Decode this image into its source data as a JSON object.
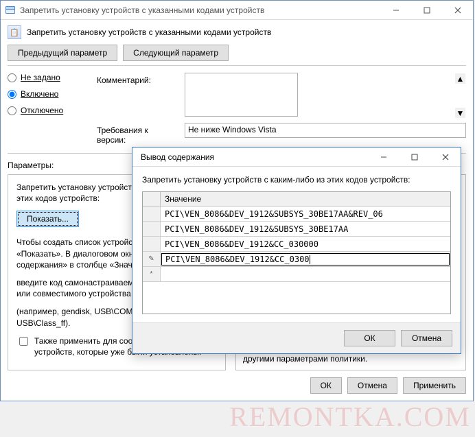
{
  "main": {
    "title": "Запретить установку устройств с указанными кодами устройств",
    "header_title": "Запретить установку устройств с указанными кодами устройств",
    "nav": {
      "prev": "Предыдущий параметр",
      "next": "Следующий параметр"
    },
    "radios": {
      "not_configured": "Не задано",
      "enabled": "Включено",
      "disabled": "Отключено",
      "selected": "enabled"
    },
    "comment_label": "Комментарий:",
    "comment_value": "",
    "req_label": "Требования к версии:",
    "req_value": "Не ниже Windows Vista",
    "params_label": "Параметры:",
    "left": {
      "p1": "Запретить установку устройств с каким-либо из этих кодов устройств:",
      "show_btn": "Показать...",
      "p2": "Чтобы создать список устройств, нажмите кнопку «Показать». В диалоговом окне «Вывод содержания» в столбце «Значение»",
      "p3": "введите код самонастраиваемого оборудования или совместимого устройства",
      "p4": "(например, gendisk, USB\\COMPOSITE, USB\\Class_ff).",
      "chk": "Также применить для соответствующих устройств, которые уже были установлены."
    },
    "right_tail": "обновлять, насколько это разрешено или запрещено другими параметрами политики.",
    "footer": {
      "ok": "ОК",
      "cancel": "Отмена",
      "apply": "Применить"
    }
  },
  "modal": {
    "title": "Вывод содержания",
    "label": "Запретить установку устройств с каким-либо из этих кодов устройств:",
    "col_header": "Значение",
    "rows": [
      "PCI\\VEN_8086&DEV_1912&SUBSYS_30BE17AA&REV_06",
      "PCI\\VEN_8086&DEV_1912&SUBSYS_30BE17AA",
      "PCI\\VEN_8086&DEV_1912&CC_030000",
      "PCI\\VEN_8086&DEV_1912&CC_0300"
    ],
    "editing_index": 3,
    "footer": {
      "ok": "ОК",
      "cancel": "Отмена"
    }
  },
  "watermark": "REMONTKA.COM"
}
